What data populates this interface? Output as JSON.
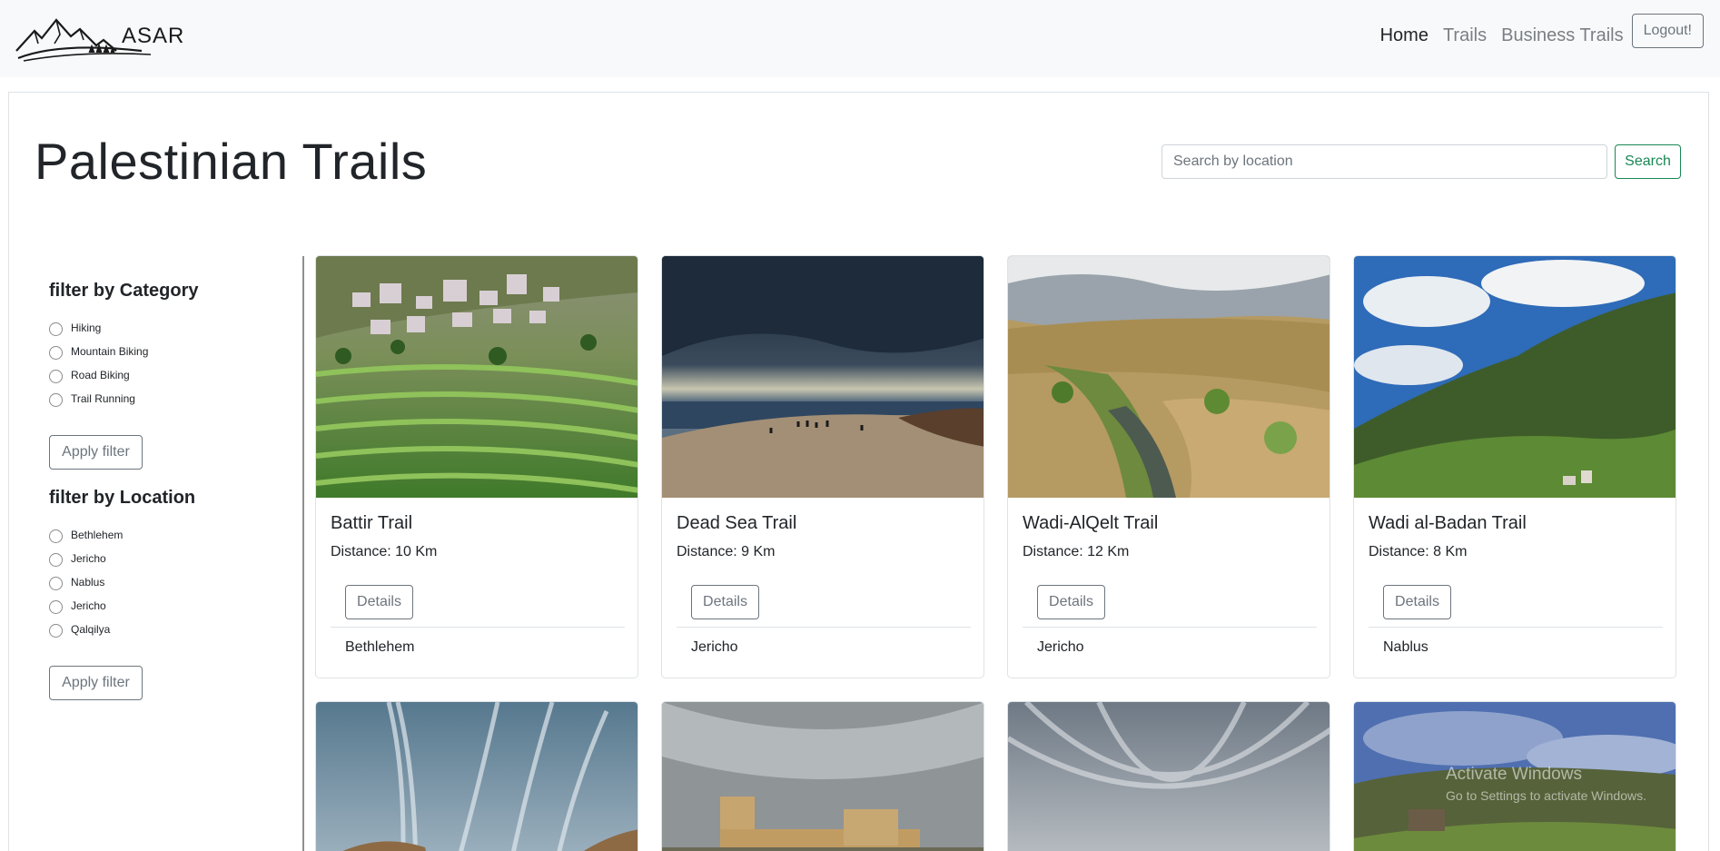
{
  "navbar": {
    "brand_text": "ASAR",
    "links": [
      {
        "label": "Home",
        "active": true
      },
      {
        "label": "Trails",
        "active": false
      },
      {
        "label": "Business Trails",
        "active": false
      }
    ],
    "logout_label": "Logout!"
  },
  "header": {
    "title": "Palestinian Trails",
    "search_placeholder": "Search by location",
    "search_label": "Search"
  },
  "sidebar": {
    "category_heading": "filter by Category",
    "categories": [
      "Hiking",
      "Mountain Biking",
      "Road Biking",
      "Trail Running"
    ],
    "category_apply_label": "Apply filter",
    "location_heading": "filter by Location",
    "locations": [
      "Bethlehem",
      "Jericho",
      "Nablus",
      "Jericho",
      "Qalqilya"
    ],
    "location_apply_label": "Apply filter"
  },
  "trails": [
    {
      "name": "Battir Trail",
      "distance": "Distance: 10 Km",
      "details_label": "Details",
      "location": "Bethlehem"
    },
    {
      "name": "Dead Sea Trail",
      "distance": "Distance: 9 Km",
      "details_label": "Details",
      "location": "Jericho"
    },
    {
      "name": "Wadi-AlQelt Trail",
      "distance": "Distance: 12 Km",
      "details_label": "Details",
      "location": "Jericho"
    },
    {
      "name": "Wadi al-Badan Trail",
      "distance": "Distance: 8 Km",
      "details_label": "Details",
      "location": "Nablus"
    }
  ],
  "watermark": {
    "line1": "Activate Windows",
    "line2": "Go to Settings to activate Windows."
  },
  "colors": {
    "navbar_bg": "#f8f9fa",
    "search_accent": "#198754",
    "secondary": "#6c757d"
  }
}
